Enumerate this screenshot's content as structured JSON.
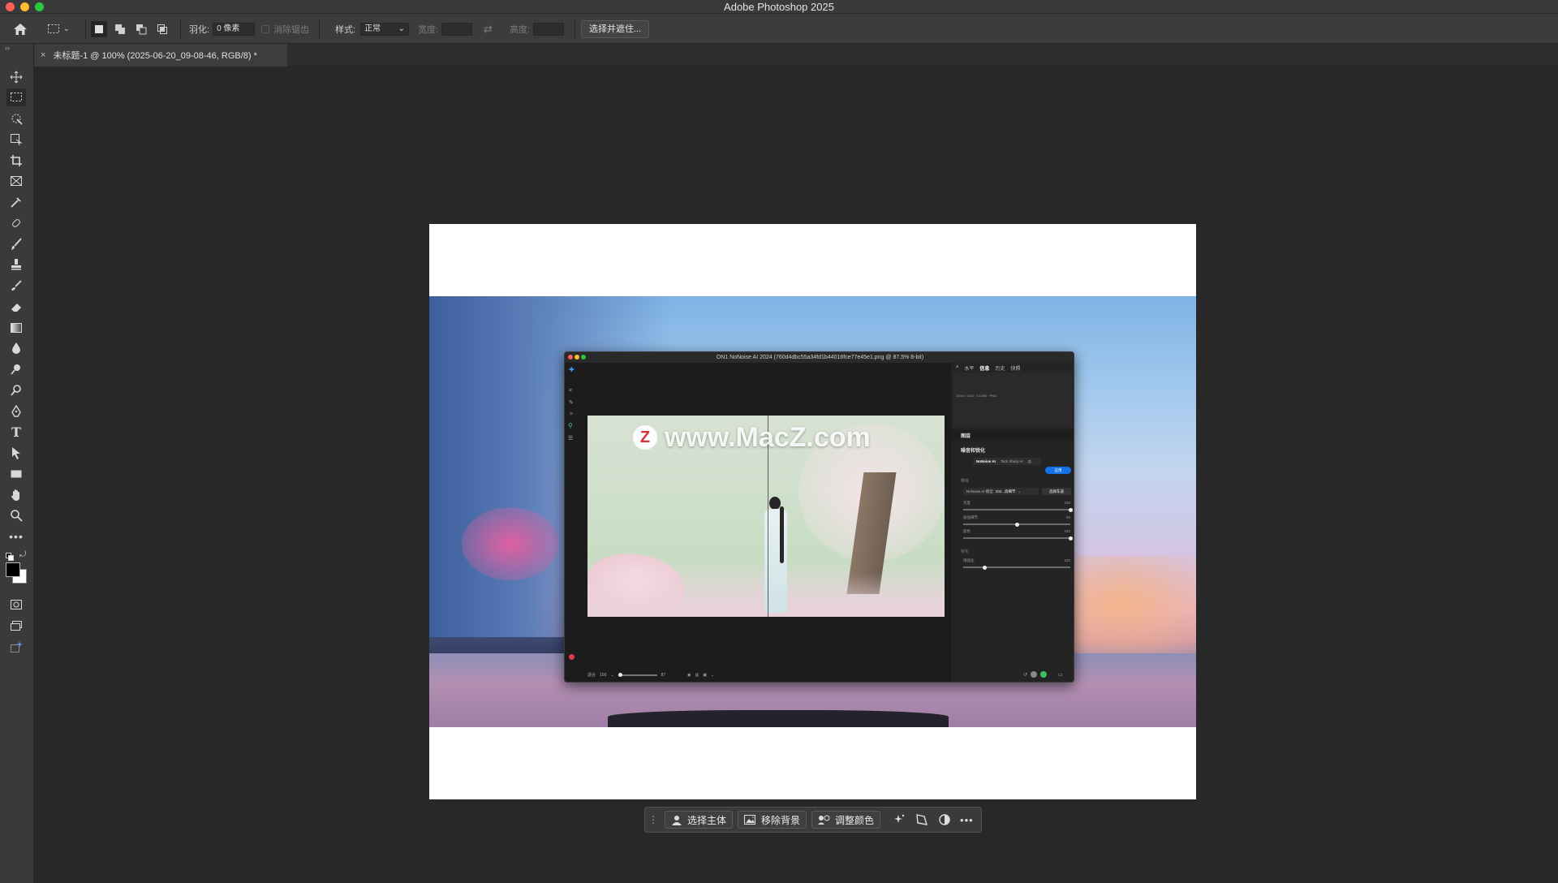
{
  "window": {
    "title": "Adobe Photoshop 2025"
  },
  "options": {
    "feather_label": "羽化:",
    "feather_value": "0 像素",
    "antialias_label": "消除锯齿",
    "style_label": "样式:",
    "style_value": "正常",
    "width_label": "宽度:",
    "height_label": "高度:",
    "select_mask_label": "选择并遮住..."
  },
  "document": {
    "tab_title": "未标题-1 @ 100% (2025-06-20_09-08-46, RGB/8) *"
  },
  "embedded_app": {
    "title": "ON1 NoNoise AI 2024 (760d4dbc55a34fd1b44016fce77e45e1.png @ 87.5% 8-bit)",
    "panel_tabs": [
      "水平",
      "信息",
      "历史",
      "快照"
    ],
    "info_text": "2048 x 1152 · 3.6 MB · PNG",
    "layers_label": "图层",
    "noise_section": "噪音和锐化",
    "mode_tabs": [
      "NoNoise AI",
      "Tack Sharp AI"
    ],
    "apply_label": "应用",
    "denoise_label": "降噪",
    "model_label": "NoNoise AI 模型",
    "model_value": "202...高细节",
    "model_button": "选择车道",
    "sliders": [
      {
        "label": "亮度",
        "value": "100",
        "level": 1.0
      },
      {
        "label": "加强细节",
        "value": "50",
        "level": 0.5
      },
      {
        "label": "颜色",
        "value": "100",
        "level": 1.0
      }
    ],
    "sharpen_label": "锐化",
    "sharpen_slider": {
      "label": "增强化",
      "value": "100",
      "level": 0.2
    },
    "zoom_fit_label": "适合",
    "zoom_value": "100",
    "zoom_slider_value": "87"
  },
  "watermark": {
    "text": "www.MacZ.com",
    "logo_letter": "Z"
  },
  "contextual_bar": {
    "select_subject": "选择主体",
    "remove_bg": "移除背景",
    "adjust_color": "调整颜色"
  },
  "colors": {
    "accent": "#1473e6",
    "window_bg": "#282828",
    "panel_bg": "#3a3a3a"
  }
}
